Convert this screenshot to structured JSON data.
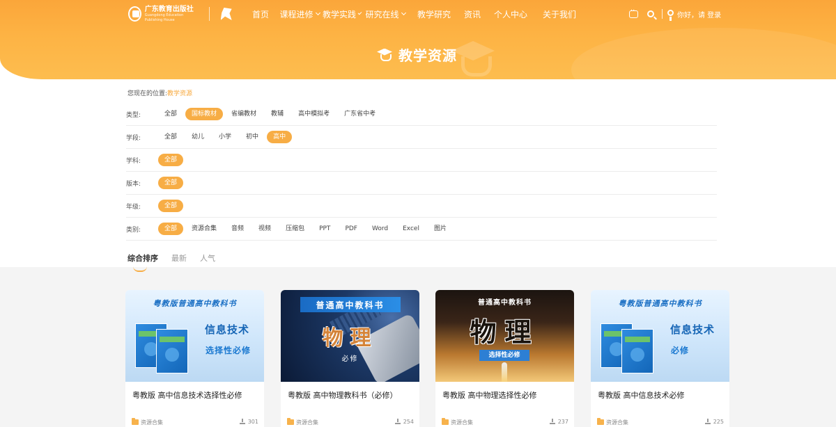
{
  "brand": {
    "name_cn": "广东教育出版社",
    "name_en": "Guangdong Education Publishing House"
  },
  "nav": {
    "items": [
      {
        "label": "首页",
        "has_dropdown": false
      },
      {
        "label": "课程进修",
        "has_dropdown": true
      },
      {
        "label": "教学实践",
        "has_dropdown": true
      },
      {
        "label": "研究在线",
        "has_dropdown": true
      },
      {
        "label": "教学研究",
        "has_dropdown": false
      },
      {
        "label": "资讯",
        "has_dropdown": false
      },
      {
        "label": "个人中心",
        "has_dropdown": false
      },
      {
        "label": "关于我们",
        "has_dropdown": false
      }
    ],
    "login": "你好，请 登录"
  },
  "page_title": "教学资源",
  "breadcrumb": {
    "prefix": "您现在的位置:",
    "current": "教学资源"
  },
  "filters": [
    {
      "label": "类型:",
      "options": [
        "全部",
        "国标教材",
        "省编教材",
        "教辅",
        "高中模拟考",
        "广东省中考"
      ],
      "active": 1
    },
    {
      "label": "学段:",
      "options": [
        "全部",
        "幼儿",
        "小学",
        "初中",
        "高中"
      ],
      "active": 4
    },
    {
      "label": "学科:",
      "options": [
        "全部"
      ],
      "active": 0
    },
    {
      "label": "版本:",
      "options": [
        "全部"
      ],
      "active": 0
    },
    {
      "label": "年级:",
      "options": [
        "全部"
      ],
      "active": 0
    },
    {
      "label": "类别:",
      "options": [
        "全部",
        "资源合集",
        "音频",
        "视频",
        "压缩包",
        "PPT",
        "PDF",
        "Word",
        "Excel",
        "图片"
      ],
      "active": 0
    }
  ],
  "sort_tabs": [
    {
      "label": "综合排序",
      "active": true
    },
    {
      "label": "最新",
      "active": false
    },
    {
      "label": "人气",
      "active": false
    }
  ],
  "cards": [
    {
      "title": "粤教版 高中信息技术选择性必修",
      "type": "资源合集",
      "downloads": "301",
      "cover": {
        "style": "it",
        "header": "粤教版普通高中教科书",
        "line1": "信息技术",
        "line2": "选择性必修"
      }
    },
    {
      "title": "粤教版 高中物理教科书（必修）",
      "type": "资源合集",
      "downloads": "254",
      "cover": {
        "style": "phy1",
        "header": "普通高中教科书",
        "line1": "物理",
        "line2": "必修"
      }
    },
    {
      "title": "粤教版 高中物理选择性必修",
      "type": "资源合集",
      "downloads": "237",
      "cover": {
        "style": "phy2",
        "header": "普通高中教科书",
        "line1": "物理",
        "line2": "选择性必修"
      }
    },
    {
      "title": "粤教版 高中信息技术必修",
      "type": "资源合集",
      "downloads": "225",
      "cover": {
        "style": "it",
        "header": "粤教版普通高中教科书",
        "line1": "信息技术",
        "line2": "必修"
      }
    }
  ],
  "colors": {
    "accent": "#f7ad45",
    "header": "#fdb344",
    "link": "#f7a83c"
  },
  "icons": [
    "message-icon",
    "search-icon",
    "user-icon",
    "graduation-cap-icon",
    "folder-icon",
    "download-icon",
    "chevron-down-icon"
  ]
}
